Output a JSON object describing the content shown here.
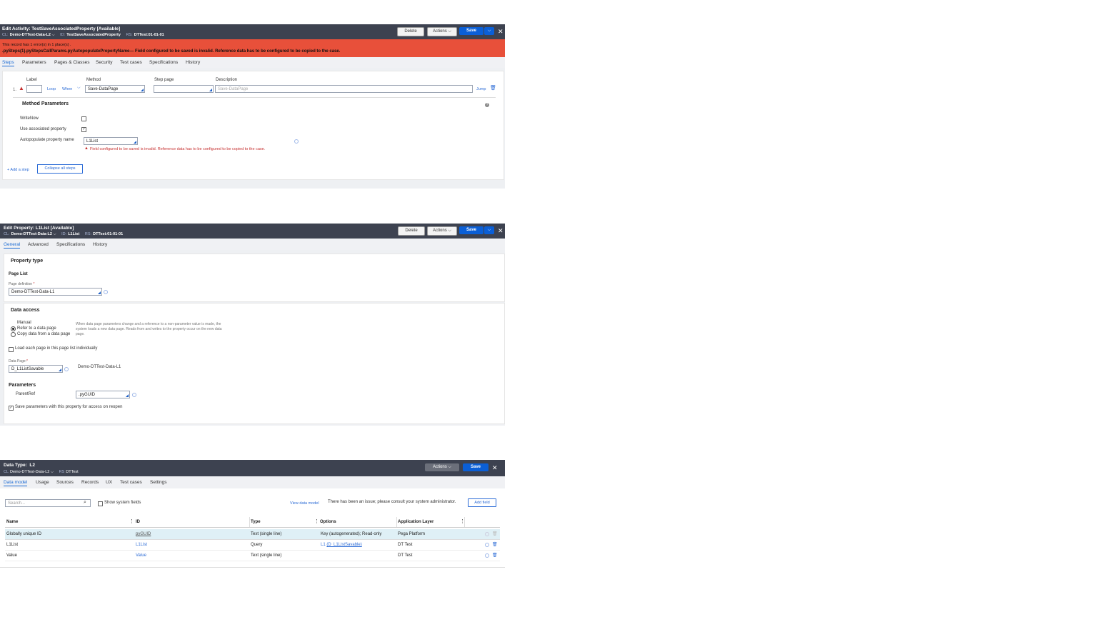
{
  "activity": {
    "title": "Edit Activity: TestSaveAssociatedProperty [Available]",
    "cl_key": "CL:",
    "cl_value": "Demo-DTTest-Data-L2",
    "id_key": "ID:",
    "id_value": "TestSaveAssociatedProperty",
    "rs_key": "RS:",
    "rs_value": "DTTest:01-01-01",
    "delete": "Delete",
    "actions": "Actions",
    "save": "Save",
    "error_count": "This record has 1 error(s) in 1 place(s) .",
    "error_detail": ".pySteps(1).pyStepsCallParams.pyAutopopulatePropertyName— Field configured to be saved is invalid. Reference data has to be configured to be copied to the case.",
    "tabs": [
      "Steps",
      "Parameters",
      "Pages & Classes",
      "Security",
      "Test cases",
      "Specifications",
      "History"
    ],
    "col_label": "Label",
    "col_method": "Method",
    "col_steppage": "Step page",
    "col_description": "Description",
    "step_num": "1.",
    "loop": "Loop",
    "when": "When",
    "method_value": "Save-DataPage",
    "description_placeholder": "Save-DataPage",
    "jump": "Jump",
    "method_params": "Method Parameters",
    "writenow": "WriteNow",
    "use_assoc": "Use associated property",
    "autopop": "Autopopulate property name",
    "autopop_value": "L1List",
    "field_error": "Field configured to be saved is invalid. Reference data has to be configured to be copied to the case.",
    "add_step": "+ Add a step",
    "collapse": "Collapse all steps"
  },
  "property": {
    "title": "Edit  Property: L1List [Available]",
    "cl_key": "CL:",
    "cl_value": "Demo-DTTest-Data-L2",
    "id_key": "ID:",
    "id_value": "L1List",
    "rs_key": "RS:",
    "rs_value": "DTTest:01-01-01",
    "delete": "Delete",
    "actions": "Actions",
    "save": "Save",
    "tabs": [
      "General",
      "Advanced",
      "Specifications",
      "History"
    ],
    "property_type": "Property type",
    "page_list": "Page List",
    "page_def_label": "Page definition",
    "page_def_value": "Demo-DTTest-Data-L1",
    "data_access": "Data access",
    "manual": "Manual",
    "refer": "Refer to a data page",
    "copy": "Copy data from a data page",
    "note": "When data page parameters change and a reference to a non-parameter value is made, the system loads a new data page. Reads from and writes to the property occur on the new data page.",
    "load_each": "Load each page in this page list individually",
    "data_page_label": "Data Page:",
    "data_page_value": "D_L1ListSavable",
    "data_page_class": "Demo-DTTest-Data-L1",
    "parameters": "Parameters",
    "parentref": "ParentRef",
    "parentref_value": ".pyGUID",
    "save_params": "Save parameters with this property for access on reopen"
  },
  "datatype": {
    "title_key": "Data Type:",
    "title_value": "L2",
    "cl_key": "CL",
    "cl_value": "Demo-DTTest-Data-L2",
    "rs_key": "RS",
    "rs_value": "DTTest",
    "actions": "Actions",
    "save": "Save",
    "tabs": [
      "Data model",
      "Usage",
      "Sources",
      "Records",
      "UX",
      "Test cases",
      "Settings"
    ],
    "search_placeholder": "Search...",
    "show_system": "Show system fields",
    "view_model": "View data model",
    "issue": "There has been an issue; please consult your system administrator.",
    "add_field": "Add field",
    "columns": [
      "Name",
      "ID",
      "Type",
      "Options",
      "Application Layer"
    ],
    "rows": [
      {
        "name": "Globally unique ID",
        "id": "pyGUID",
        "type": "Text (single line)",
        "options": "Key (autogenerated); Read-only",
        "layer": "Pega Platform"
      },
      {
        "name": "L1List",
        "id": "L1List",
        "type": "Query",
        "options_a": "L1",
        "options_b": "(D_L1ListSavable)",
        "layer": "DT Test"
      },
      {
        "name": "Value",
        "id": "Value",
        "type": "Text (single line)",
        "options": "",
        "layer": "DT Test"
      }
    ]
  },
  "colors": {
    "header": "#3d4250",
    "error_bar": "#e8503a",
    "save": "#0b5fd6",
    "link": "#2b6bd6"
  }
}
